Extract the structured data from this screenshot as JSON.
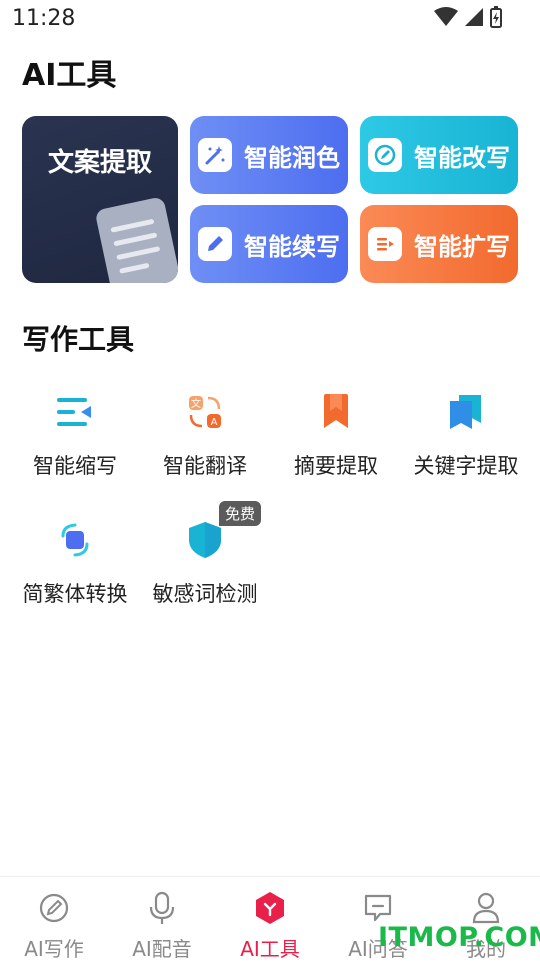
{
  "status_bar": {
    "time": "11:28"
  },
  "page_title": "AI工具",
  "ai_tools": {
    "feature_card": "文案提取",
    "cards": [
      {
        "label": "智能润色",
        "icon": "magic-wand-icon"
      },
      {
        "label": "智能改写",
        "icon": "edit-circle-icon"
      },
      {
        "label": "智能续写",
        "icon": "pencil-icon"
      },
      {
        "label": "智能扩写",
        "icon": "expand-text-icon"
      }
    ]
  },
  "writing_tools": {
    "title": "写作工具",
    "items": [
      {
        "label": "智能缩写",
        "icon": "shrink-lines-icon"
      },
      {
        "label": "智能翻译",
        "icon": "translate-icon"
      },
      {
        "label": "摘要提取",
        "icon": "bookmark-icon"
      },
      {
        "label": "关键字提取",
        "icon": "double-bookmark-icon"
      },
      {
        "label": "简繁体转换",
        "icon": "convert-icon"
      },
      {
        "label": "敏感词检测",
        "icon": "shield-icon"
      }
    ],
    "free_badge": "免费"
  },
  "bottom_nav": {
    "items": [
      {
        "label": "AI写作",
        "icon": "pen-circle-icon"
      },
      {
        "label": "AI配音",
        "icon": "microphone-icon"
      },
      {
        "label": "AI工具",
        "icon": "tools-hexagon-icon"
      },
      {
        "label": "AI问答",
        "icon": "chat-icon"
      },
      {
        "label": "我的",
        "icon": "person-icon"
      }
    ],
    "active": "AI工具"
  },
  "watermark": "ITMOP.COM",
  "colors": {
    "accent": "#e8204a",
    "blue": "#4d6ef0",
    "cyan": "#19b3d4",
    "orange": "#f26a2e",
    "dark": "#1f2740"
  }
}
